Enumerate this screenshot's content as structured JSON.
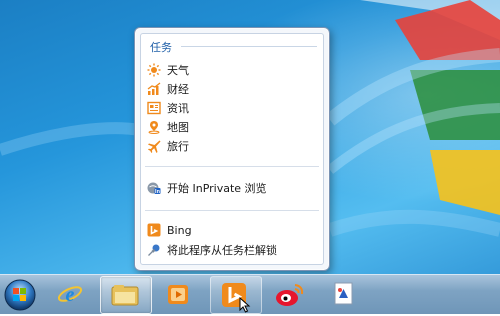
{
  "jumplist": {
    "section_title": "任务",
    "tasks": [
      {
        "label": "天气",
        "icon": "sun-icon"
      },
      {
        "label": "财经",
        "icon": "chart-icon"
      },
      {
        "label": "资讯",
        "icon": "news-icon"
      },
      {
        "label": "地图",
        "icon": "map-pin-icon"
      },
      {
        "label": "旅行",
        "icon": "airplane-icon"
      }
    ],
    "inprivate_label": "开始 InPrivate 浏览",
    "app_label": "Bing",
    "unpin_label": "将此程序从任务栏解锁"
  },
  "taskbar": {
    "buttons": [
      {
        "name": "start-button",
        "icon": "windows-orb-icon"
      },
      {
        "name": "ie",
        "icon": "internet-explorer-icon"
      },
      {
        "name": "explorer",
        "icon": "folder-icon",
        "state": "active"
      },
      {
        "name": "media-player",
        "icon": "media-player-icon"
      },
      {
        "name": "bing",
        "icon": "bing-icon",
        "state": "hover"
      },
      {
        "name": "weibo",
        "icon": "weibo-icon"
      },
      {
        "name": "paint",
        "icon": "paint-icon"
      }
    ]
  },
  "colors": {
    "accent_orange": "#f08a1c",
    "section_title": "#1f5fa8"
  }
}
